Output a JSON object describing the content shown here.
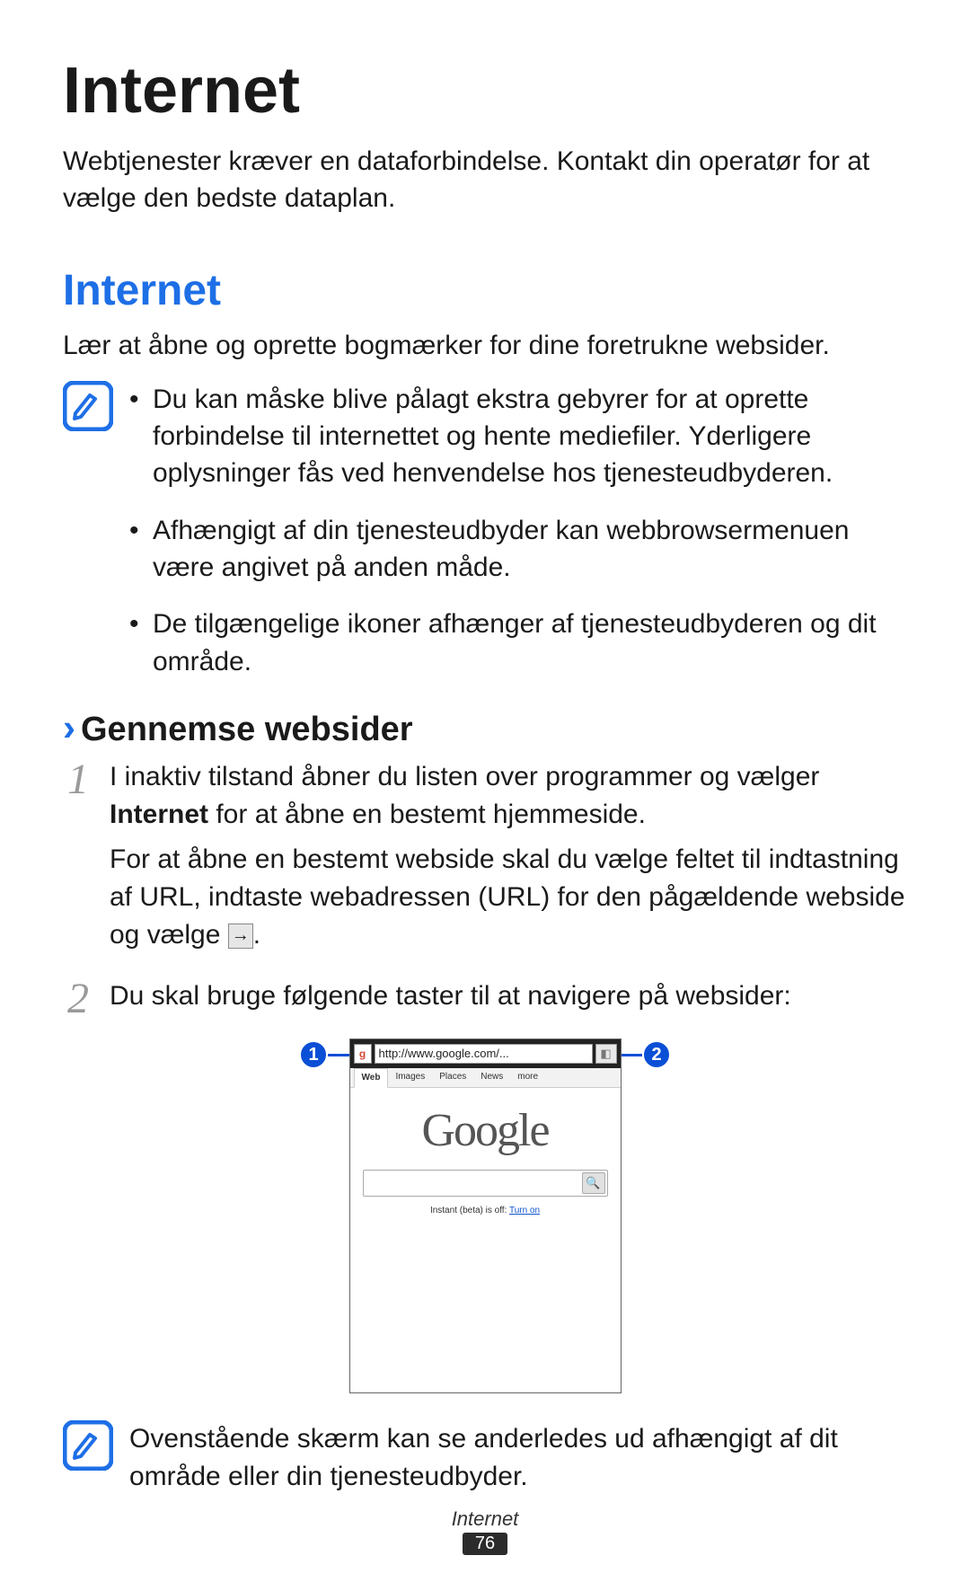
{
  "page": {
    "title": "Internet",
    "intro": "Webtjenester kræver en dataforbindelse. Kontakt din operatør for at vælge den bedste dataplan."
  },
  "section": {
    "heading": "Internet",
    "intro": "Lær at åbne og oprette bogmærker for dine foretrukne websider."
  },
  "note1": {
    "items": [
      "Du kan måske blive pålagt ekstra gebyrer for at oprette forbindelse til internettet og hente mediefiler. Yderligere oplysninger fås ved henvendelse hos tjenesteudbyderen.",
      "Afhængigt af din tjenesteudbyder kan webbrowsermenuen være angivet på anden måde.",
      "De tilgængelige ikoner afhænger af tjenesteudbyderen og dit område."
    ]
  },
  "subsection": {
    "chevron": "›",
    "heading": "Gennemse websider"
  },
  "steps": {
    "s1": {
      "num": "1",
      "part1_pre": "I inaktiv tilstand åbner du listen over programmer og vælger ",
      "bold": "Internet",
      "part1_post": " for at åbne en bestemt hjemmeside.",
      "p2_pre": "For at åbne en bestemt webside skal du vælge feltet til indtastning af URL, indtaste webadressen (URL) for den pågældende webside og vælge ",
      "p2_post": "."
    },
    "s2": {
      "num": "2",
      "text": "Du skal bruge følgende taster til at navigere på websider:"
    }
  },
  "screenshot": {
    "callouts": {
      "c1": "1",
      "c2": "2"
    },
    "url": "http://www.google.com/...",
    "tabs": {
      "web": "Web",
      "images": "Images",
      "places": "Places",
      "news": "News",
      "more": "more"
    },
    "logo": "Google",
    "instant_pre": "Instant (beta) is off: ",
    "instant_link": "Turn on"
  },
  "note2": {
    "text": "Ovenstående skærm kan se anderledes ud afhængigt af dit område eller din tjenesteudbyder."
  },
  "footer": {
    "label": "Internet",
    "page_num": "76"
  }
}
